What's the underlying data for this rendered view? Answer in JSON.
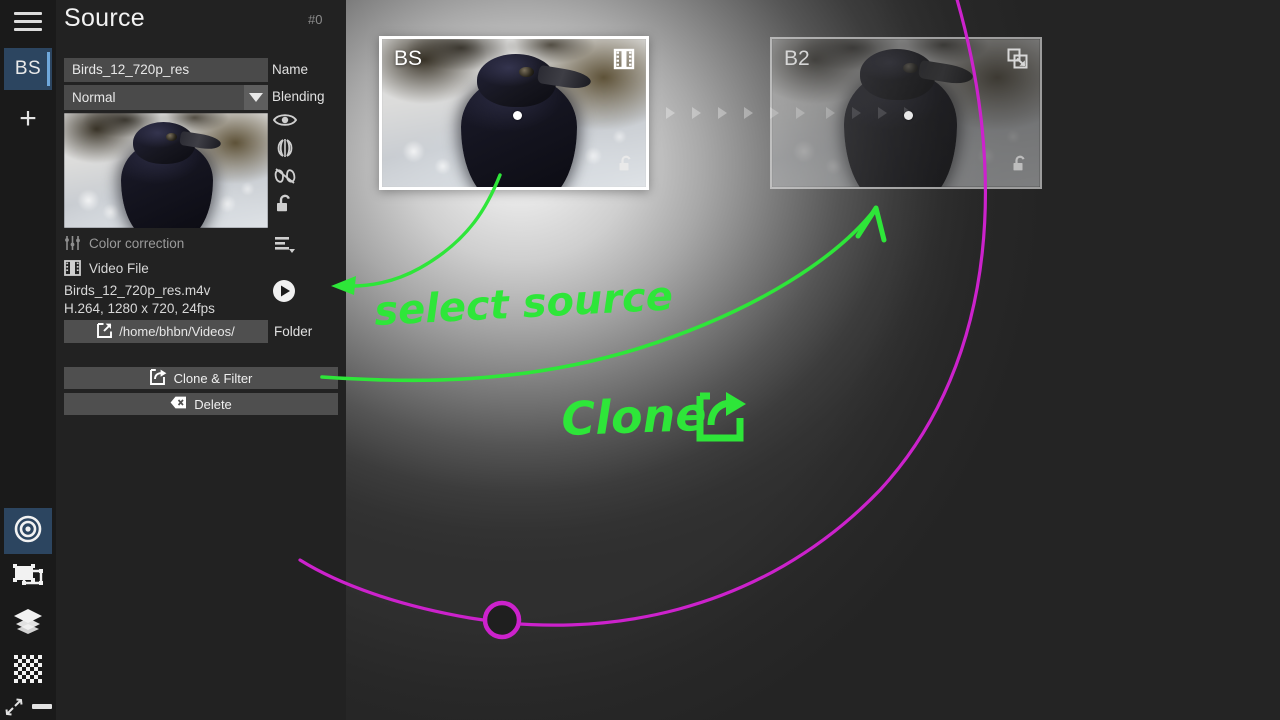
{
  "app": {
    "panel_title": "Source",
    "panel_index": "#0",
    "accent_blue": "#2c4560",
    "accent_blue_light": "#6fa8dc",
    "annotation_green": "#2ee639",
    "handle_magenta": "#cc22cc"
  },
  "rail": {
    "menu_icon": "hamburger-menu-icon",
    "tab_label": "BS",
    "add_label": "+",
    "tools": [
      {
        "name": "target-tool",
        "icon": "target-icon",
        "active": true
      },
      {
        "name": "transform-tool",
        "icon": "transform-frame-icon",
        "active": false
      },
      {
        "name": "layers-tool",
        "icon": "layers-stack-icon",
        "active": false
      },
      {
        "name": "checker-tool",
        "icon": "checkerboard-icon",
        "active": false
      }
    ],
    "collapse_icon": "collapse-arrows-icon",
    "minimize_icon": "minimize-dash-icon"
  },
  "source": {
    "name_value": "Birds_12_720p_res",
    "name_placeholder": "Name",
    "name_label": "Name",
    "blending_value": "Normal",
    "blending_label": "Blending",
    "blending_options": [
      "Normal"
    ],
    "thumbnail_alt": "source-preview-thumbnail",
    "side_icons": [
      {
        "name": "visibility-eye-icon",
        "label": "eye-icon"
      },
      {
        "name": "flip-mirror-icon",
        "label": "mirror-icon"
      },
      {
        "name": "unlink-chain-icon",
        "label": "broken-link-icon"
      },
      {
        "name": "unlock-padlock-icon",
        "label": "unlock-icon"
      },
      {
        "name": "list-menu-icon",
        "label": "menu-list-icon"
      }
    ],
    "color_correction_label": "Color correction",
    "video_file_label": "Video File",
    "file_name": "Birds_12_720p_res.m4v",
    "file_specs": "H.264, 1280 x 720, 24fps",
    "folder_path": "/home/bhbn/Videos/",
    "folder_label": "Folder",
    "play_icon": "play-button-icon",
    "clone_button": "Clone & Filter",
    "delete_button": "Delete"
  },
  "stage": {
    "panels": [
      {
        "id": "source-panel",
        "label": "BS",
        "corner_icon": "film-strip-icon",
        "lock_icon": "unlock-icon",
        "selected": true
      },
      {
        "id": "clone-panel",
        "label": "B2",
        "corner_icon": "clone-copy-icon",
        "lock_icon": "unlock-icon",
        "selected": false
      }
    ],
    "flow_marker": "arrow-chain-marker"
  },
  "annotations": {
    "select_source_text": "select source",
    "clone_text": "Clone",
    "clone_icon": "share-export-icon"
  }
}
